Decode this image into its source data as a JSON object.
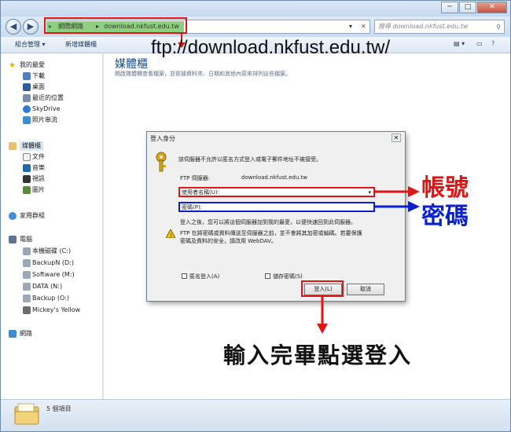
{
  "window": {
    "minimize": "─",
    "maximize": "□",
    "close": "✕"
  },
  "nav": {
    "address_segments": [
      "網際網路",
      "download.nkfust.edu.tw"
    ],
    "search_placeholder": "搜尋 download.nkfust.edu.tw"
  },
  "toolbar": {
    "organize": "組合管理 ▾",
    "new_library": "新增媒體櫃"
  },
  "sidebar": {
    "favorites_header": "我的最愛",
    "favorites": [
      "下載",
      "桌面",
      "最近的位置",
      "SkyDrive",
      "照片串流"
    ],
    "libraries_header": "媒體櫃",
    "libraries": [
      "文件",
      "音樂",
      "視訊",
      "圖片"
    ],
    "homegroup": "家用群組",
    "computer_header": "電腦",
    "drives": [
      "本機磁碟 (C:)",
      "BackupN (D:)",
      "Software (M:)",
      "DATA (N:)",
      "Backup (O:)",
      "Mickey's Yellow"
    ],
    "network": "網路"
  },
  "content": {
    "title": "媒體櫃",
    "subtitle": "開啟媒體櫃查看檔案，並依據資料夾、日期和其他內容來排列這些檔案。"
  },
  "status": {
    "count": "5 個項目"
  },
  "dialog": {
    "title": "登入身分",
    "message": "該伺服器不允許以匿名方式登入或電子郵件地址不被接受。",
    "server_label": "FTP 伺服器:",
    "server_value": "download.nkfust.edu.tw",
    "username_label": "使用者名稱(U):",
    "password_label": "密碼(P):",
    "info": "登入之後，您可以將這個伺服器加到我的最愛，以便快速回到此伺服器。",
    "warning_line1": "FTP 在將密碼或資料傳送至伺服器之前，並不會將其加密或編碼。若要保護",
    "warning_line2": "密碼及資料的安全，請改用 WebDAV。",
    "anon_login": "匿名登入(A)",
    "save_password": "儲存密碼(S)",
    "login_button": "登入(L)",
    "cancel_button": "取消"
  },
  "annotations": {
    "url": "ftp://download.nkfust.edu.tw/",
    "account": "帳號",
    "password": "密碼",
    "instruction": "輸入完畢點選登入"
  },
  "colors": {
    "highlight_red": "#e01515",
    "highlight_blue": "#0a1fd0",
    "address_green": "#8ed07f"
  }
}
